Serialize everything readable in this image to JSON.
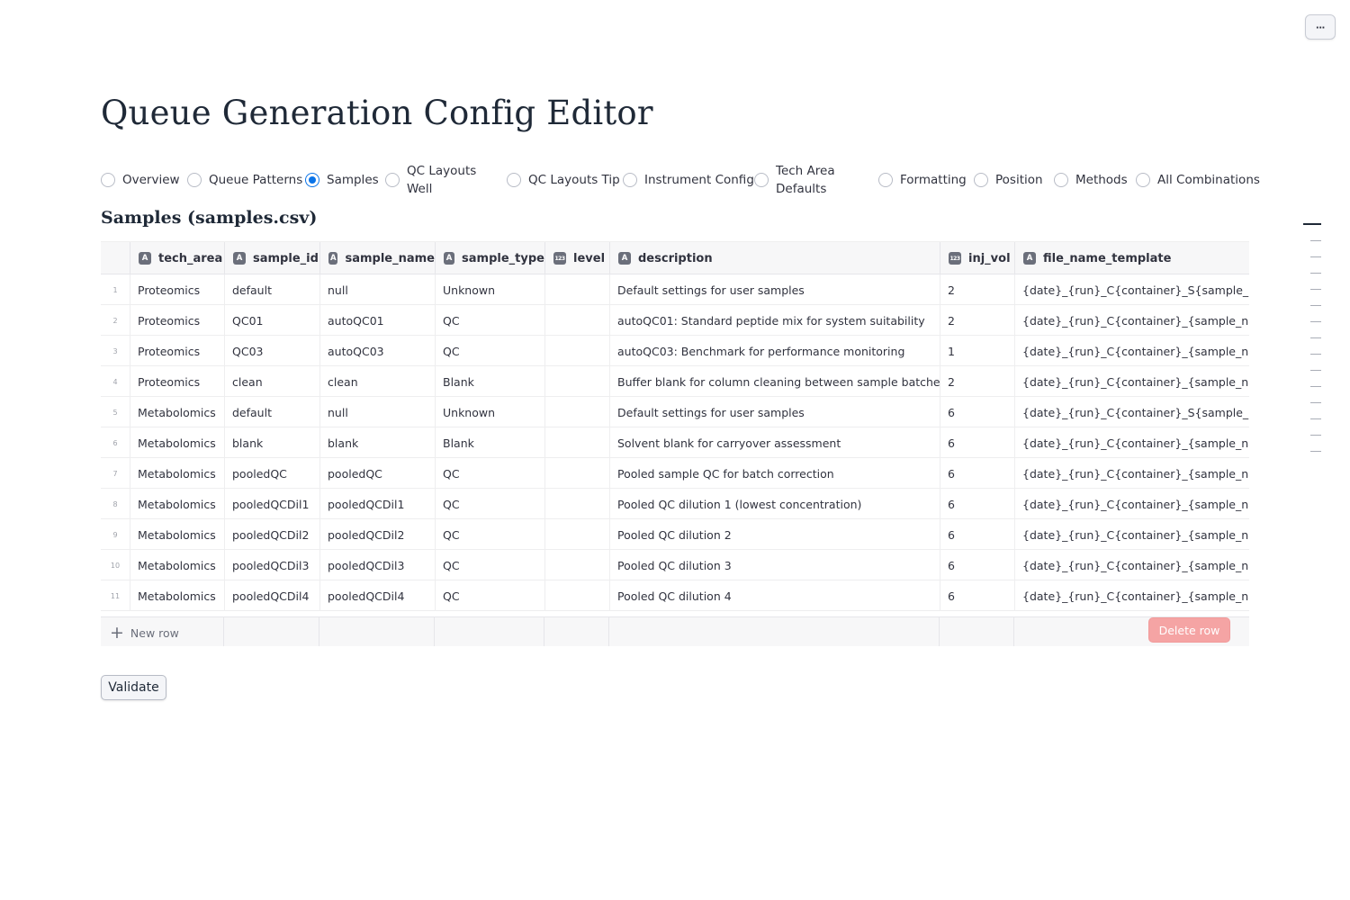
{
  "page": {
    "title": "Queue Generation Config Editor",
    "menu_label": "···"
  },
  "tabs": [
    {
      "label": "Overview",
      "selected": false
    },
    {
      "label": "Queue Patterns",
      "selected": false
    },
    {
      "label": "Samples",
      "selected": true
    },
    {
      "label": "QC Layouts\nWell",
      "selected": false
    },
    {
      "label": "QC Layouts Tip",
      "selected": false
    },
    {
      "label": "Instrument Config",
      "selected": false
    },
    {
      "label": "Tech Area\nDefaults",
      "selected": false
    },
    {
      "label": "Formatting",
      "selected": false
    },
    {
      "label": "Position",
      "selected": false
    },
    {
      "label": "Methods",
      "selected": false
    },
    {
      "label": "All Combinations",
      "selected": false
    }
  ],
  "section": {
    "title": "Samples (samples.csv)"
  },
  "table": {
    "columns": [
      {
        "name": "tech_area",
        "type_icon": "A"
      },
      {
        "name": "sample_id",
        "type_icon": "A"
      },
      {
        "name": "sample_name",
        "type_icon": "A"
      },
      {
        "name": "sample_type",
        "type_icon": "A"
      },
      {
        "name": "level",
        "type_icon": "123"
      },
      {
        "name": "description",
        "type_icon": "A"
      },
      {
        "name": "inj_vol",
        "type_icon": "123"
      },
      {
        "name": "file_name_template",
        "type_icon": "A"
      }
    ],
    "rows": [
      {
        "index": "1",
        "cells": [
          "Proteomics",
          "default",
          "null",
          "Unknown",
          "",
          "Default settings for user samples",
          "2",
          "{date}_{run}_C{container}_S{sample_id}_{"
        ]
      },
      {
        "index": "2",
        "cells": [
          "Proteomics",
          "QC01",
          "autoQC01",
          "QC",
          "",
          "autoQC01: Standard peptide mix for system suitability",
          "2",
          "{date}_{run}_C{container}_{sample_name"
        ]
      },
      {
        "index": "3",
        "cells": [
          "Proteomics",
          "QC03",
          "autoQC03",
          "QC",
          "",
          "autoQC03: Benchmark for performance monitoring",
          "1",
          "{date}_{run}_C{container}_{sample_name"
        ]
      },
      {
        "index": "4",
        "cells": [
          "Proteomics",
          "clean",
          "clean",
          "Blank",
          "",
          "Buffer blank for column cleaning between sample batches",
          "2",
          "{date}_{run}_C{container}_{sample_name"
        ]
      },
      {
        "index": "5",
        "cells": [
          "Metabolomics",
          "default",
          "null",
          "Unknown",
          "",
          "Default settings for user samples",
          "6",
          "{date}_{run}_C{container}_S{sample_id}_{"
        ]
      },
      {
        "index": "6",
        "cells": [
          "Metabolomics",
          "blank",
          "blank",
          "Blank",
          "",
          "Solvent blank for carryover assessment",
          "6",
          "{date}_{run}_C{container}_{sample_name"
        ]
      },
      {
        "index": "7",
        "cells": [
          "Metabolomics",
          "pooledQC",
          "pooledQC",
          "QC",
          "",
          "Pooled sample QC for batch correction",
          "6",
          "{date}_{run}_C{container}_{sample_name"
        ]
      },
      {
        "index": "8",
        "cells": [
          "Metabolomics",
          "pooledQCDil1",
          "pooledQCDil1",
          "QC",
          "",
          "Pooled QC dilution 1 (lowest concentration)",
          "6",
          "{date}_{run}_C{container}_{sample_name"
        ]
      },
      {
        "index": "9",
        "cells": [
          "Metabolomics",
          "pooledQCDil2",
          "pooledQCDil2",
          "QC",
          "",
          "Pooled QC dilution 2",
          "6",
          "{date}_{run}_C{container}_{sample_name"
        ]
      },
      {
        "index": "10",
        "cells": [
          "Metabolomics",
          "pooledQCDil3",
          "pooledQCDil3",
          "QC",
          "",
          "Pooled QC dilution 3",
          "6",
          "{date}_{run}_C{container}_{sample_name"
        ]
      },
      {
        "index": "11",
        "cells": [
          "Metabolomics",
          "pooledQCDil4",
          "pooledQCDil4",
          "QC",
          "",
          "Pooled QC dilution 4",
          "6",
          "{date}_{run}_C{container}_{sample_name"
        ]
      }
    ],
    "new_row_label": "New row",
    "delete_row_label": "Delete row"
  },
  "actions": {
    "validate_label": "Validate"
  },
  "colors": {
    "accent": "#0a73e8",
    "delete": "#f5a4a4"
  }
}
